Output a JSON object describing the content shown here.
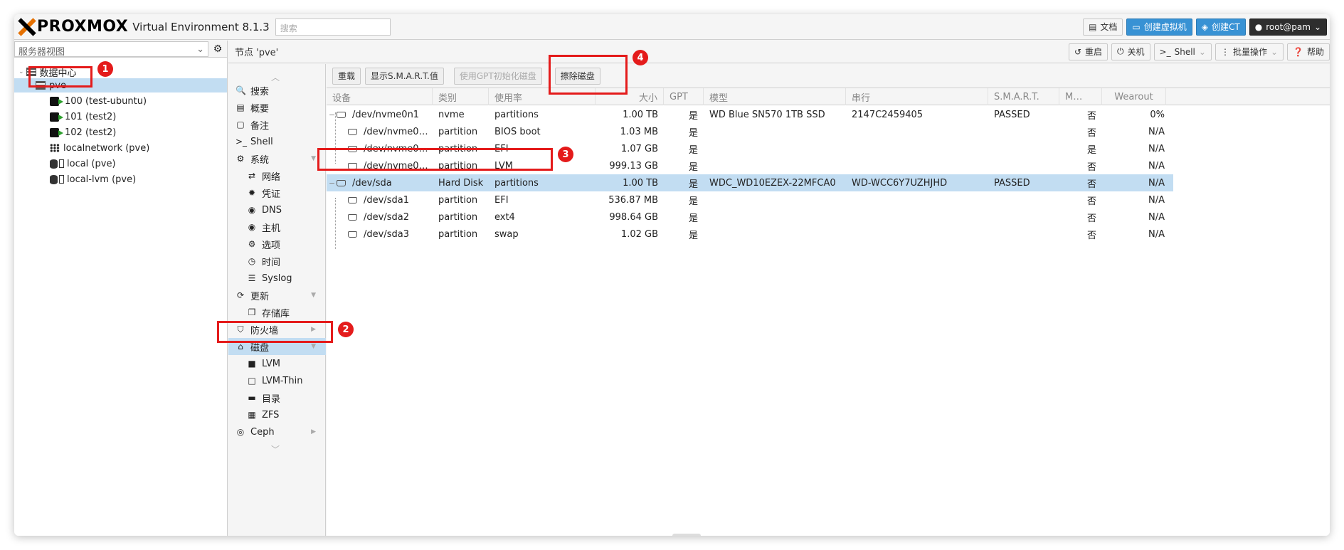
{
  "header": {
    "logo_text": "PROXMOX",
    "version": "Virtual Environment 8.1.3",
    "search_placeholder": "搜索",
    "buttons": {
      "docs": "文档",
      "create_vm": "创建虚拟机",
      "create_ct": "创建CT",
      "user": "root@pam"
    }
  },
  "sidebar": {
    "view_select": "服务器视图",
    "tree": {
      "datacenter": "数据中心",
      "node": "pve",
      "vms": [
        "100 (test-ubuntu)",
        "101 (test2)",
        "102 (test2)"
      ],
      "network": "localnetwork (pve)",
      "storages": [
        "local (pve)",
        "local-lvm (pve)"
      ]
    }
  },
  "node_bar": {
    "title": "节点 'pve'",
    "buttons": {
      "reboot": "重启",
      "shutdown": "关机",
      "shell": "Shell",
      "bulk": "批量操作",
      "help": "帮助"
    }
  },
  "menu": {
    "search": "搜索",
    "summary": "概要",
    "notes": "备注",
    "shell": "Shell",
    "system": "系统",
    "network": "网络",
    "certificates": "凭证",
    "dns": "DNS",
    "hosts": "主机",
    "options": "选项",
    "time": "时间",
    "syslog": "Syslog",
    "updates": "更新",
    "repositories": "存储库",
    "firewall": "防火墙",
    "disks": "磁盘",
    "lvm": "LVM",
    "lvm_thin": "LVM-Thin",
    "directory": "目录",
    "zfs": "ZFS",
    "ceph": "Ceph"
  },
  "toolbar": {
    "reload": "重载",
    "show_smart": "显示S.M.A.R.T.值",
    "init_gpt": "使用GPT初始化磁盘",
    "wipe_disk": "擦除磁盘"
  },
  "grid": {
    "columns": [
      "设备",
      "类别",
      "使用率",
      "大小",
      "GPT",
      "模型",
      "串行",
      "S.M.A.R.T.",
      "M…",
      "Wearout"
    ],
    "rows": [
      {
        "device": "/dev/nvme0n1",
        "type": "nvme",
        "usage": "partitions",
        "size": "1.00 TB",
        "gpt": "是",
        "model": "WD Blue SN570 1TB SSD",
        "serial": "2147C2459405",
        "smart": "PASSED",
        "mounted": "否",
        "wearout": "0%"
      },
      {
        "device": "/dev/nvme0…",
        "type": "partition",
        "usage": "BIOS boot",
        "size": "1.03 MB",
        "gpt": "是",
        "model": "",
        "serial": "",
        "smart": "",
        "mounted": "否",
        "wearout": "N/A"
      },
      {
        "device": "/dev/nvme0…",
        "type": "partition",
        "usage": "EFI",
        "size": "1.07 GB",
        "gpt": "是",
        "model": "",
        "serial": "",
        "smart": "",
        "mounted": "是",
        "wearout": "N/A"
      },
      {
        "device": "/dev/nvme0…",
        "type": "partition",
        "usage": "LVM",
        "size": "999.13 GB",
        "gpt": "是",
        "model": "",
        "serial": "",
        "smart": "",
        "mounted": "否",
        "wearout": "N/A"
      },
      {
        "device": "/dev/sda",
        "type": "Hard Disk",
        "usage": "partitions",
        "size": "1.00 TB",
        "gpt": "是",
        "model": "WDC_WD10EZEX-22MFCA0",
        "serial": "WD-WCC6Y7UZHJHD",
        "smart": "PASSED",
        "mounted": "否",
        "wearout": "N/A"
      },
      {
        "device": "/dev/sda1",
        "type": "partition",
        "usage": "EFI",
        "size": "536.87 MB",
        "gpt": "是",
        "model": "",
        "serial": "",
        "smart": "",
        "mounted": "否",
        "wearout": "N/A"
      },
      {
        "device": "/dev/sda2",
        "type": "partition",
        "usage": "ext4",
        "size": "998.64 GB",
        "gpt": "是",
        "model": "",
        "serial": "",
        "smart": "",
        "mounted": "否",
        "wearout": "N/A"
      },
      {
        "device": "/dev/sda3",
        "type": "partition",
        "usage": "swap",
        "size": "1.02 GB",
        "gpt": "是",
        "model": "",
        "serial": "",
        "smart": "",
        "mounted": "否",
        "wearout": "N/A"
      }
    ]
  },
  "annotations": [
    "1",
    "2",
    "3",
    "4"
  ],
  "colors": {
    "accent": "#e41b1b",
    "selection": "#c2ddf2",
    "brand": "#e57000",
    "button_blue": "#3892d4"
  }
}
